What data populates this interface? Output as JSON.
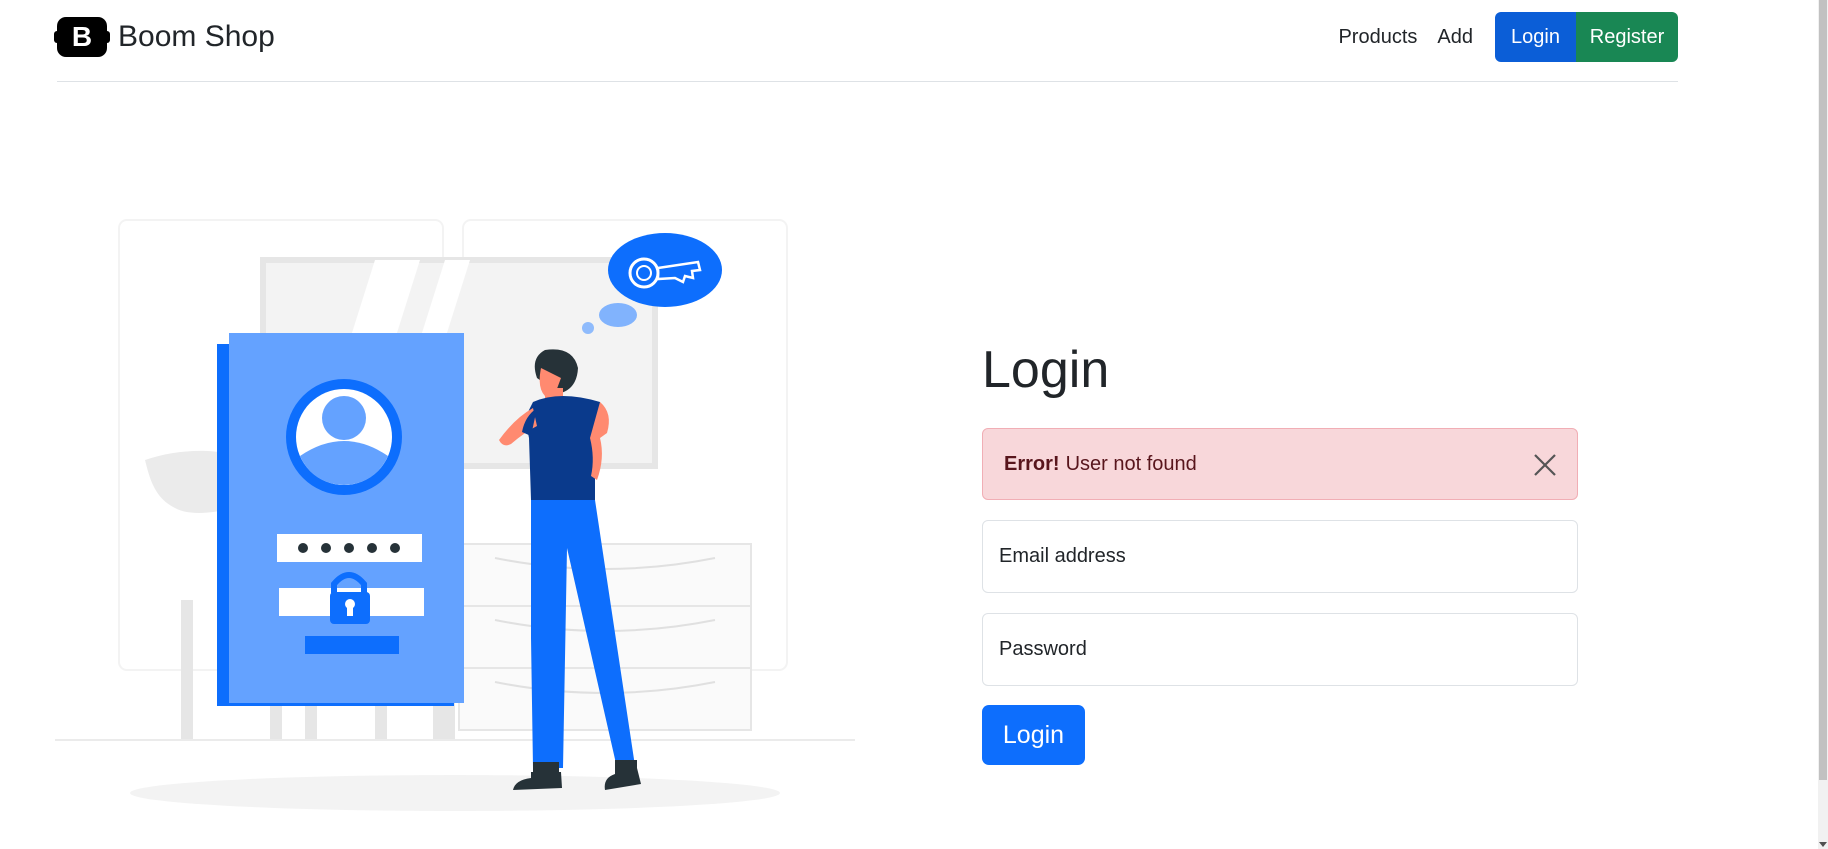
{
  "header": {
    "brand_logo": "B",
    "brand_name": "Boom Shop",
    "nav": {
      "products": "Products",
      "add": "Add",
      "login": "Login",
      "register": "Register"
    }
  },
  "main": {
    "title": "Login",
    "alert": {
      "strong": "Error!",
      "message": "User not found"
    },
    "email": {
      "placeholder": "Email address"
    },
    "password": {
      "placeholder": "Password"
    },
    "submit_label": "Login"
  },
  "colors": {
    "primary": "#0d6efd",
    "login_nav": "#0b5ed7",
    "success": "#198754",
    "alert_bg": "#f8d7da",
    "alert_text": "#58151c",
    "illustration_blue": "#0d6efd",
    "illustration_light_blue": "#64a2ff",
    "illustration_navy": "#0a3a8c"
  },
  "icons": {
    "brand": "bootstrap-logo-icon",
    "close": "close-icon",
    "illustration": "login-illustration"
  }
}
